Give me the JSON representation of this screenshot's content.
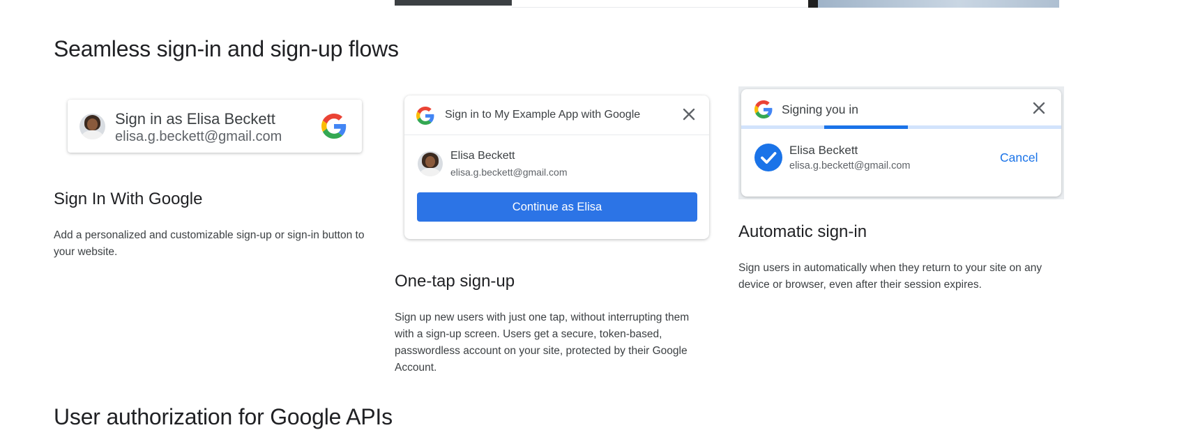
{
  "heading": "Seamless sign-in and sign-up flows",
  "next_heading": "User authorization for Google APIs",
  "features": [
    {
      "title": "Sign In With Google",
      "description": "Add a personalized and customizable sign-up or sign-in button to your website.",
      "preview": {
        "button_name": "Sign in as Elisa Beckett",
        "email": "elisa.g.beckett@gmail.com",
        "icon": "google-logo-icon"
      }
    },
    {
      "title": "One-tap sign-up",
      "description": "Sign up new users with just one tap, without interrupting them with a sign-up screen. Users get a secure, token-based, passwordless account on your site, protected by their Google Account.",
      "preview": {
        "header": "Sign in to My Example App with Google",
        "name": "Elisa Beckett",
        "email": "elisa.g.beckett@gmail.com",
        "button": "Continue as Elisa",
        "close_icon": "close-icon"
      }
    },
    {
      "title": "Automatic sign-in",
      "description": "Sign users in automatically when they return to your site on any device or browser, even after their session expires.",
      "preview": {
        "header": "Signing you in",
        "name": "Elisa Beckett",
        "email": "elisa.g.beckett@gmail.com",
        "cancel": "Cancel",
        "progress_fraction": 0.26,
        "progress_start_fraction": 0.26,
        "check_icon": "check-circle-icon",
        "close_icon": "close-icon"
      }
    }
  ],
  "colors": {
    "primary_button": "#2c74e6",
    "link_blue": "#1a73e8",
    "progress_track": "#d2e3fc"
  }
}
